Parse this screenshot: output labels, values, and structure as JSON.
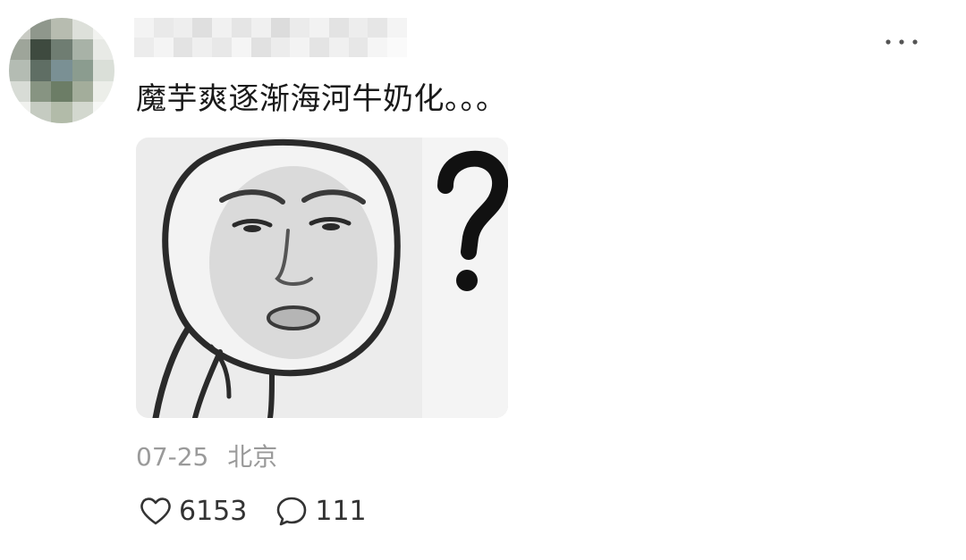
{
  "post": {
    "text": "魔芋爽逐渐海河牛奶化。。。",
    "date": "07-25",
    "location": "北京",
    "image_icon": "confused-meme-image"
  },
  "stats": {
    "likes": "6153",
    "comments": "111"
  },
  "icons": {
    "more": "more-icon",
    "like": "heart-icon",
    "comment": "comment-bubble-icon"
  },
  "colors": {
    "text": "#1a1a1a",
    "meta": "#9a9a9a",
    "count": "#333333"
  }
}
